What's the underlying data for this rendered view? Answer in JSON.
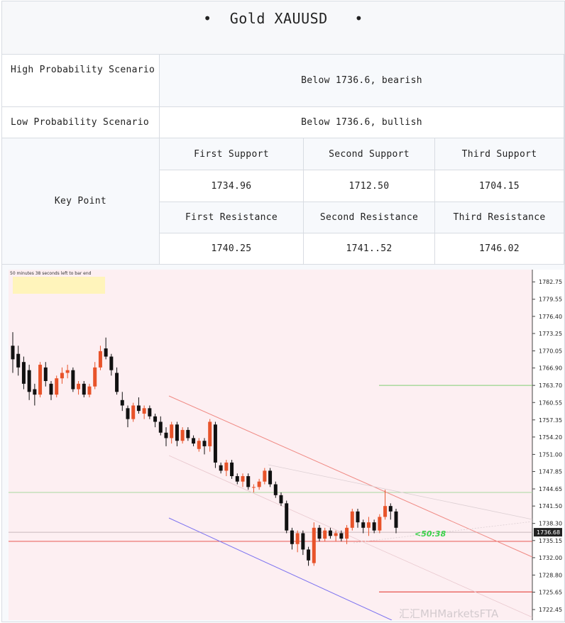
{
  "title": "Gold XAUUSD",
  "scenarios": {
    "high_label": "High Probability Scenario",
    "high_value": "Below 1736.6, bearish",
    "low_label": "Low Probability Scenario",
    "low_value": "Below 1736.6, bullish"
  },
  "key_point": {
    "label": "Key Point",
    "support_headers": [
      "First Support",
      "Second Support",
      "Third Support"
    ],
    "support_values": [
      "1734.96",
      "1712.50",
      "1704.15"
    ],
    "resistance_headers": [
      "First Resistance",
      "Second Resistance",
      "Third Resistance"
    ],
    "resistance_values": [
      "1740.25",
      "1741..52",
      "1746.02"
    ]
  },
  "colors": {
    "bull": "#e8532a",
    "bear": "#111111",
    "chart_bg": "#fdeff2",
    "channel_red": "#f08a84",
    "channel_blue": "#7d73f0",
    "level_green": "#7fcf72",
    "level_red": "#e3413b",
    "timer_green": "#39d24a"
  },
  "chart_data": {
    "type": "candlestick",
    "header_text": "50 minutes 38 seconds left to bar end",
    "timer": "<50:38",
    "current_price": "1736.68",
    "watermark": "汇汇MHMarketsFTA",
    "ylim": [
      1720.5,
      1785.0
    ],
    "y_ticks": [
      "1782.75",
      "1779.55",
      "1776.40",
      "1773.25",
      "1770.05",
      "1766.90",
      "1763.70",
      "1760.55",
      "1757.35",
      "1754.20",
      "1751.00",
      "1747.85",
      "1744.65",
      "1741.50",
      "1738.30",
      "1735.15",
      "1732.00",
      "1728.80",
      "1725.65",
      "1722.45"
    ],
    "candles": [
      {
        "o": 1771.0,
        "h": 1773.5,
        "l": 1766.0,
        "c": 1768.5
      },
      {
        "o": 1769.5,
        "h": 1771.0,
        "l": 1765.5,
        "c": 1767.0
      },
      {
        "o": 1768.0,
        "h": 1769.0,
        "l": 1763.0,
        "c": 1764.0
      },
      {
        "o": 1766.5,
        "h": 1767.5,
        "l": 1761.0,
        "c": 1762.5
      },
      {
        "o": 1763.0,
        "h": 1764.0,
        "l": 1760.0,
        "c": 1762.0
      },
      {
        "o": 1762.0,
        "h": 1768.0,
        "l": 1761.5,
        "c": 1767.5
      },
      {
        "o": 1767.0,
        "h": 1768.0,
        "l": 1763.5,
        "c": 1764.5
      },
      {
        "o": 1764.0,
        "h": 1764.5,
        "l": 1761.0,
        "c": 1762.0
      },
      {
        "o": 1762.0,
        "h": 1765.5,
        "l": 1761.5,
        "c": 1765.0
      },
      {
        "o": 1765.0,
        "h": 1767.0,
        "l": 1764.0,
        "c": 1766.0
      },
      {
        "o": 1766.0,
        "h": 1767.5,
        "l": 1765.0,
        "c": 1766.5
      },
      {
        "o": 1766.5,
        "h": 1767.0,
        "l": 1762.5,
        "c": 1763.0
      },
      {
        "o": 1763.0,
        "h": 1764.5,
        "l": 1762.0,
        "c": 1764.0
      },
      {
        "o": 1764.0,
        "h": 1764.5,
        "l": 1761.5,
        "c": 1762.0
      },
      {
        "o": 1762.0,
        "h": 1764.0,
        "l": 1761.5,
        "c": 1763.5
      },
      {
        "o": 1763.5,
        "h": 1768.0,
        "l": 1763.0,
        "c": 1767.0
      },
      {
        "o": 1767.0,
        "h": 1771.0,
        "l": 1766.5,
        "c": 1770.0
      },
      {
        "o": 1770.5,
        "h": 1772.5,
        "l": 1768.5,
        "c": 1769.0
      },
      {
        "o": 1769.0,
        "h": 1769.5,
        "l": 1765.5,
        "c": 1766.5
      },
      {
        "o": 1766.0,
        "h": 1767.0,
        "l": 1762.0,
        "c": 1762.5
      },
      {
        "o": 1761.0,
        "h": 1762.5,
        "l": 1759.0,
        "c": 1760.0
      },
      {
        "o": 1759.5,
        "h": 1760.0,
        "l": 1756.0,
        "c": 1757.5
      },
      {
        "o": 1757.5,
        "h": 1760.5,
        "l": 1757.0,
        "c": 1760.0
      },
      {
        "o": 1760.0,
        "h": 1761.5,
        "l": 1758.5,
        "c": 1759.0
      },
      {
        "o": 1758.5,
        "h": 1760.0,
        "l": 1757.5,
        "c": 1759.5
      },
      {
        "o": 1759.5,
        "h": 1760.0,
        "l": 1757.5,
        "c": 1758.0
      },
      {
        "o": 1758.0,
        "h": 1758.5,
        "l": 1756.0,
        "c": 1757.0
      },
      {
        "o": 1757.0,
        "h": 1758.0,
        "l": 1754.5,
        "c": 1755.0
      },
      {
        "o": 1755.0,
        "h": 1756.0,
        "l": 1752.5,
        "c": 1754.0
      },
      {
        "o": 1754.0,
        "h": 1757.0,
        "l": 1753.0,
        "c": 1756.5
      },
      {
        "o": 1756.5,
        "h": 1757.0,
        "l": 1752.5,
        "c": 1753.5
      },
      {
        "o": 1753.5,
        "h": 1756.0,
        "l": 1753.0,
        "c": 1755.5
      },
      {
        "o": 1755.5,
        "h": 1756.0,
        "l": 1753.5,
        "c": 1754.0
      },
      {
        "o": 1754.0,
        "h": 1754.5,
        "l": 1752.5,
        "c": 1753.0
      },
      {
        "o": 1752.0,
        "h": 1754.0,
        "l": 1751.5,
        "c": 1753.5
      },
      {
        "o": 1753.5,
        "h": 1754.0,
        "l": 1751.0,
        "c": 1752.5
      },
      {
        "o": 1752.5,
        "h": 1757.5,
        "l": 1751.5,
        "c": 1757.0
      },
      {
        "o": 1756.5,
        "h": 1757.0,
        "l": 1748.5,
        "c": 1749.5
      },
      {
        "o": 1749.0,
        "h": 1749.5,
        "l": 1747.5,
        "c": 1748.0
      },
      {
        "o": 1748.0,
        "h": 1750.0,
        "l": 1747.0,
        "c": 1749.5
      },
      {
        "o": 1749.5,
        "h": 1750.0,
        "l": 1746.5,
        "c": 1747.0
      },
      {
        "o": 1747.0,
        "h": 1747.5,
        "l": 1745.5,
        "c": 1746.0
      },
      {
        "o": 1746.0,
        "h": 1747.5,
        "l": 1745.0,
        "c": 1747.0
      },
      {
        "o": 1747.0,
        "h": 1747.5,
        "l": 1744.5,
        "c": 1745.0
      },
      {
        "o": 1745.0,
        "h": 1745.5,
        "l": 1744.0,
        "c": 1745.0
      },
      {
        "o": 1745.0,
        "h": 1746.5,
        "l": 1744.5,
        "c": 1746.0
      },
      {
        "o": 1746.0,
        "h": 1748.5,
        "l": 1745.5,
        "c": 1748.0
      },
      {
        "o": 1748.0,
        "h": 1748.5,
        "l": 1745.0,
        "c": 1745.5
      },
      {
        "o": 1745.5,
        "h": 1746.0,
        "l": 1743.0,
        "c": 1743.5
      },
      {
        "o": 1743.5,
        "h": 1744.0,
        "l": 1741.5,
        "c": 1742.0
      },
      {
        "o": 1742.0,
        "h": 1742.5,
        "l": 1736.5,
        "c": 1737.0
      },
      {
        "o": 1737.0,
        "h": 1737.5,
        "l": 1733.5,
        "c": 1734.5
      },
      {
        "o": 1734.5,
        "h": 1737.0,
        "l": 1733.0,
        "c": 1736.5
      },
      {
        "o": 1736.5,
        "h": 1737.0,
        "l": 1732.5,
        "c": 1733.5
      },
      {
        "o": 1733.5,
        "h": 1734.0,
        "l": 1730.5,
        "c": 1731.5
      },
      {
        "o": 1731.0,
        "h": 1738.5,
        "l": 1730.5,
        "c": 1737.5
      },
      {
        "o": 1737.5,
        "h": 1738.0,
        "l": 1735.0,
        "c": 1735.5
      },
      {
        "o": 1735.5,
        "h": 1737.5,
        "l": 1735.0,
        "c": 1737.0
      },
      {
        "o": 1737.0,
        "h": 1737.5,
        "l": 1735.5,
        "c": 1736.0
      },
      {
        "o": 1736.0,
        "h": 1737.0,
        "l": 1735.0,
        "c": 1736.5
      },
      {
        "o": 1736.5,
        "h": 1737.0,
        "l": 1735.0,
        "c": 1735.5
      },
      {
        "o": 1735.5,
        "h": 1738.0,
        "l": 1734.5,
        "c": 1737.5
      },
      {
        "o": 1737.5,
        "h": 1741.0,
        "l": 1737.0,
        "c": 1740.5
      },
      {
        "o": 1740.5,
        "h": 1741.0,
        "l": 1737.5,
        "c": 1738.5
      },
      {
        "o": 1738.5,
        "h": 1739.0,
        "l": 1736.5,
        "c": 1737.5
      },
      {
        "o": 1737.5,
        "h": 1739.5,
        "l": 1736.0,
        "c": 1738.5
      },
      {
        "o": 1738.5,
        "h": 1739.0,
        "l": 1736.5,
        "c": 1737.0
      },
      {
        "o": 1737.0,
        "h": 1740.0,
        "l": 1736.5,
        "c": 1739.5
      },
      {
        "o": 1739.5,
        "h": 1744.5,
        "l": 1739.0,
        "c": 1741.5
      },
      {
        "o": 1741.5,
        "h": 1742.0,
        "l": 1739.0,
        "c": 1740.5
      },
      {
        "o": 1740.5,
        "h": 1741.0,
        "l": 1736.5,
        "c": 1737.5
      }
    ],
    "levels": {
      "green_high": 1763.7,
      "green_mid": 1744.0,
      "price_line": 1736.68,
      "red_line": 1735.0,
      "red_low": 1725.7
    }
  }
}
